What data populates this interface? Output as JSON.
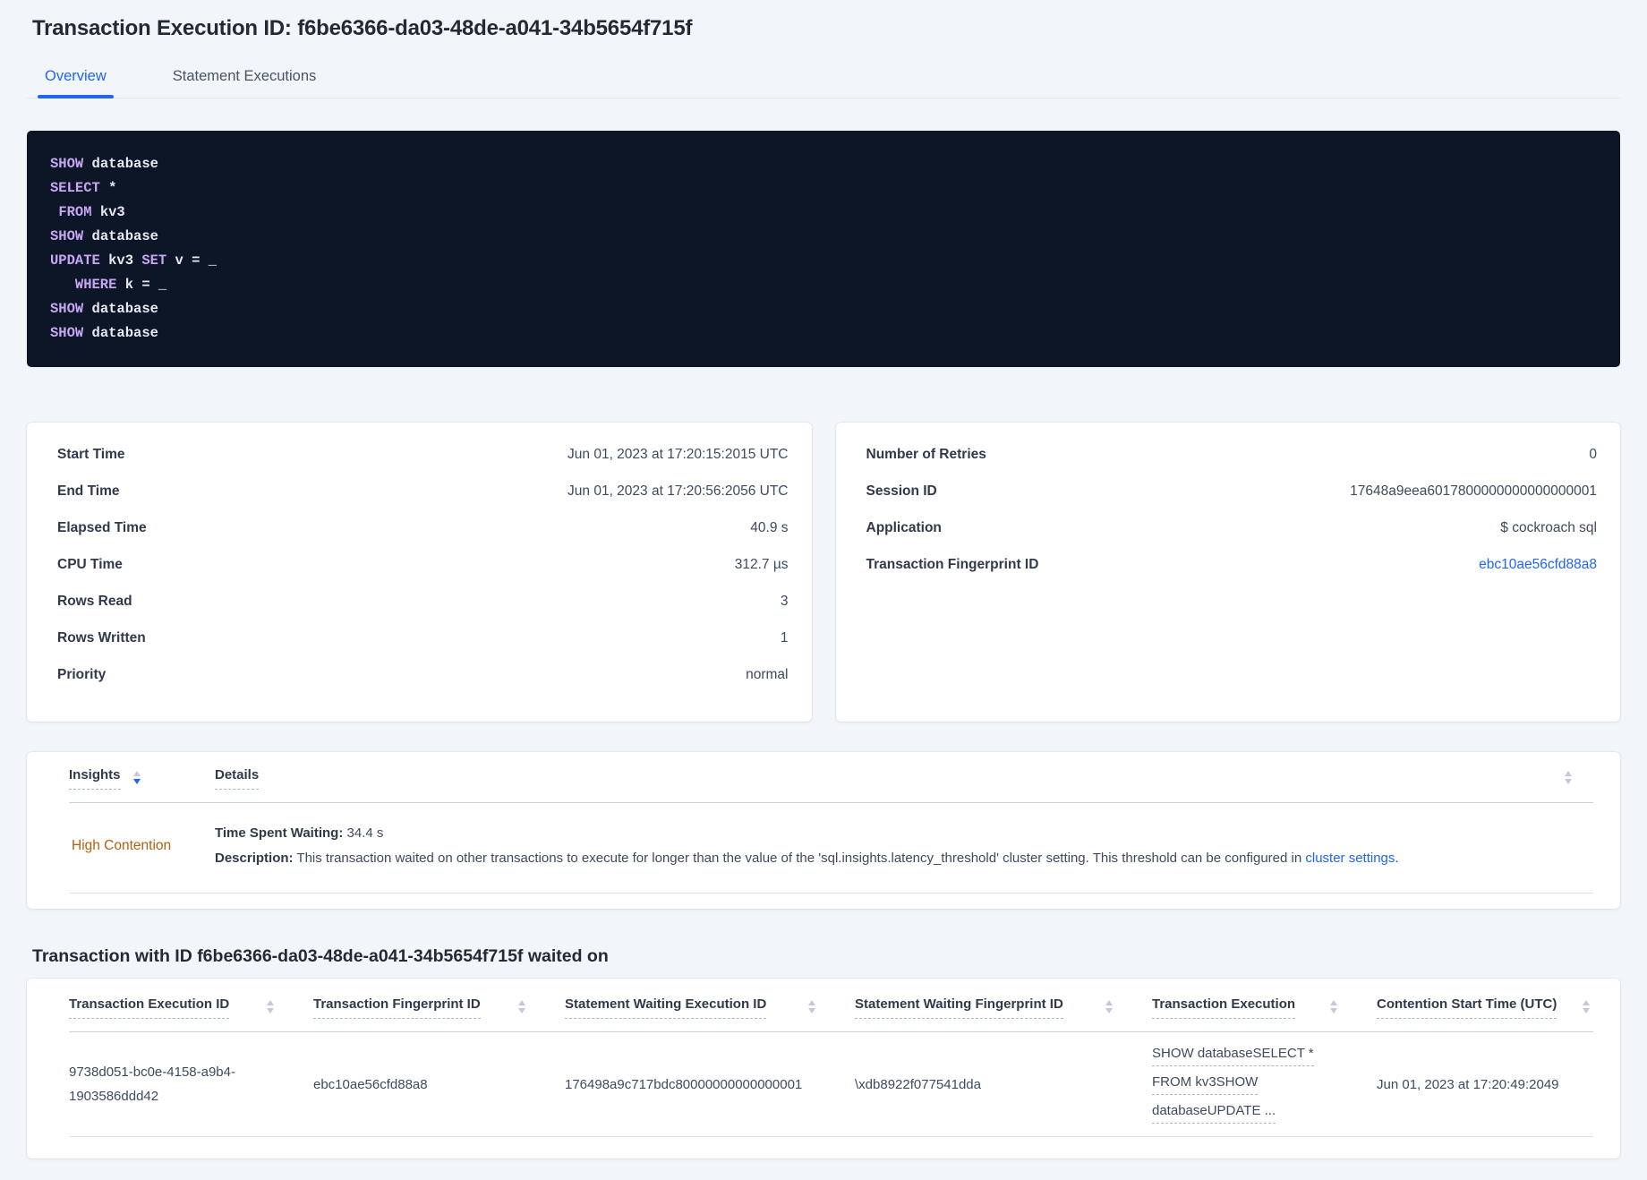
{
  "colors": {
    "accent_blue": "#2265f1",
    "insight_orange": "#b35f10",
    "code_background": "#0d1626",
    "code_keyword_purple": "#c7a6f4",
    "page_background": "#f2f5f9"
  },
  "header": {
    "title": "Transaction Execution ID: f6be6366-da03-48de-a041-34b5654f715f"
  },
  "tabs": {
    "overview": "Overview",
    "statement_executions": "Statement Executions"
  },
  "sql": {
    "lines": [
      {
        "t0": "SHOW",
        "t1": " database"
      },
      {
        "t0": "SELECT",
        "t1": " *"
      },
      {
        "t0": " ",
        "t1": "FROM",
        "t2": " kv3"
      },
      {
        "t0": "SHOW",
        "t1": " database"
      },
      {
        "t0": "UPDATE",
        "t1": " kv3 ",
        "t2": "SET",
        "t3": " v = _"
      },
      {
        "t0": "   ",
        "t1": "WHERE",
        "t2": " k = _"
      },
      {
        "t0": "SHOW",
        "t1": " database"
      },
      {
        "t0": "SHOW",
        "t1": " database"
      }
    ]
  },
  "summary_left": {
    "rows": [
      {
        "label": "Start Time",
        "value": "Jun 01, 2023 at 17:20:15:2015 UTC"
      },
      {
        "label": "End Time",
        "value": "Jun 01, 2023 at 17:20:56:2056 UTC"
      },
      {
        "label": "Elapsed Time",
        "value": "40.9 s"
      },
      {
        "label": "CPU Time",
        "value": "312.7 µs"
      },
      {
        "label": "Rows Read",
        "value": "3"
      },
      {
        "label": "Rows Written",
        "value": "1"
      },
      {
        "label": "Priority",
        "value": "normal"
      }
    ]
  },
  "summary_right": {
    "rows": [
      {
        "label": "Number of Retries",
        "value": "0"
      },
      {
        "label": "Session ID",
        "value": "17648a9eea6017800000000000000001"
      },
      {
        "label": "Application",
        "value": "$ cockroach sql"
      },
      {
        "label": "Transaction Fingerprint ID",
        "value": "ebc10ae56cfd88a8"
      }
    ]
  },
  "insights": {
    "col_insights": "Insights",
    "col_details": "Details",
    "row": {
      "insight": "High Contention",
      "waiting_label": "Time Spent Waiting:",
      "waiting_value": " 34.4 s",
      "description_label": "Description:",
      "description_text": " This transaction waited on other transactions to execute for longer than the value of the 'sql.insights.latency_threshold' cluster setting. This threshold can be configured in ",
      "description_link": "cluster settings",
      "description_period": "."
    }
  },
  "waited": {
    "heading": "Transaction with ID f6be6366-da03-48de-a041-34b5654f715f waited on",
    "columns": [
      "Transaction Execution ID",
      "Transaction Fingerprint ID",
      "Statement Waiting Execution ID",
      "Statement Waiting Fingerprint ID",
      "Transaction Execution",
      "Contention Start Time (UTC)"
    ],
    "row": {
      "txn_exec_id_line1": "9738d051-bc0e-4158-a9b4-",
      "txn_exec_id_line2": "1903586ddd42",
      "txn_fingerprint_id": "ebc10ae56cfd88a8",
      "stmt_waiting_exec_id": "176498a9c717bdc80000000000000001",
      "stmt_waiting_fingerprint_id": "\\xdb8922f077541dda",
      "txn_exec_line1": "SHOW databaseSELECT *",
      "txn_exec_line2": "FROM kv3SHOW",
      "txn_exec_line3": "databaseUPDATE ...",
      "contention_start_time": "Jun 01, 2023 at 17:20:49:2049"
    }
  }
}
